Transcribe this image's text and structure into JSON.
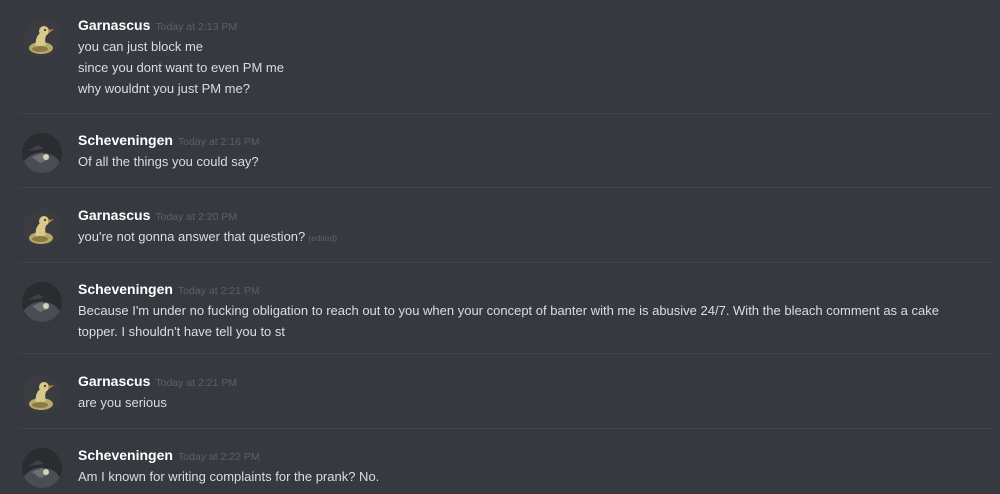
{
  "messages": [
    {
      "author": "Garnascus",
      "avatar": "duck-avatar-icon",
      "timestamp": "Today at 2:13 PM",
      "lines": [
        "you can just block me",
        "since you dont want to even PM me",
        "why wouldnt you just PM me?"
      ]
    },
    {
      "author": "Scheveningen",
      "avatar": "dark-figure-avatar-icon",
      "timestamp": "Today at 2:16 PM",
      "lines": [
        "Of all the things you could say?"
      ]
    },
    {
      "author": "Garnascus",
      "avatar": "duck-avatar-icon",
      "timestamp": "Today at 2:20 PM",
      "lines": [
        "you're not gonna answer that question?"
      ],
      "edited_label": "(edited)"
    },
    {
      "author": "Scheveningen",
      "avatar": "dark-figure-avatar-icon",
      "timestamp": "Today at 2:21 PM",
      "lines": [
        "Because I'm under no fucking obligation to reach out to you when your concept of banter with me is abusive 24/7. With the bleach comment as a cake",
        "topper. I shouldn't have  tell you to st"
      ]
    },
    {
      "author": "Garnascus",
      "avatar": "duck-avatar-icon",
      "timestamp": "Today at 2:21 PM",
      "lines": [
        "are you serious"
      ]
    },
    {
      "author": "Scheveningen",
      "avatar": "dark-figure-avatar-icon",
      "timestamp": "Today at 2:22 PM",
      "lines": [
        "Am I known for writing complaints for the prank? No."
      ]
    }
  ],
  "colors": {
    "background": "#36393f",
    "username": "#ffffff",
    "message_text": "#dcddde",
    "timestamp": "#5d6066",
    "divider": "#40434a"
  }
}
